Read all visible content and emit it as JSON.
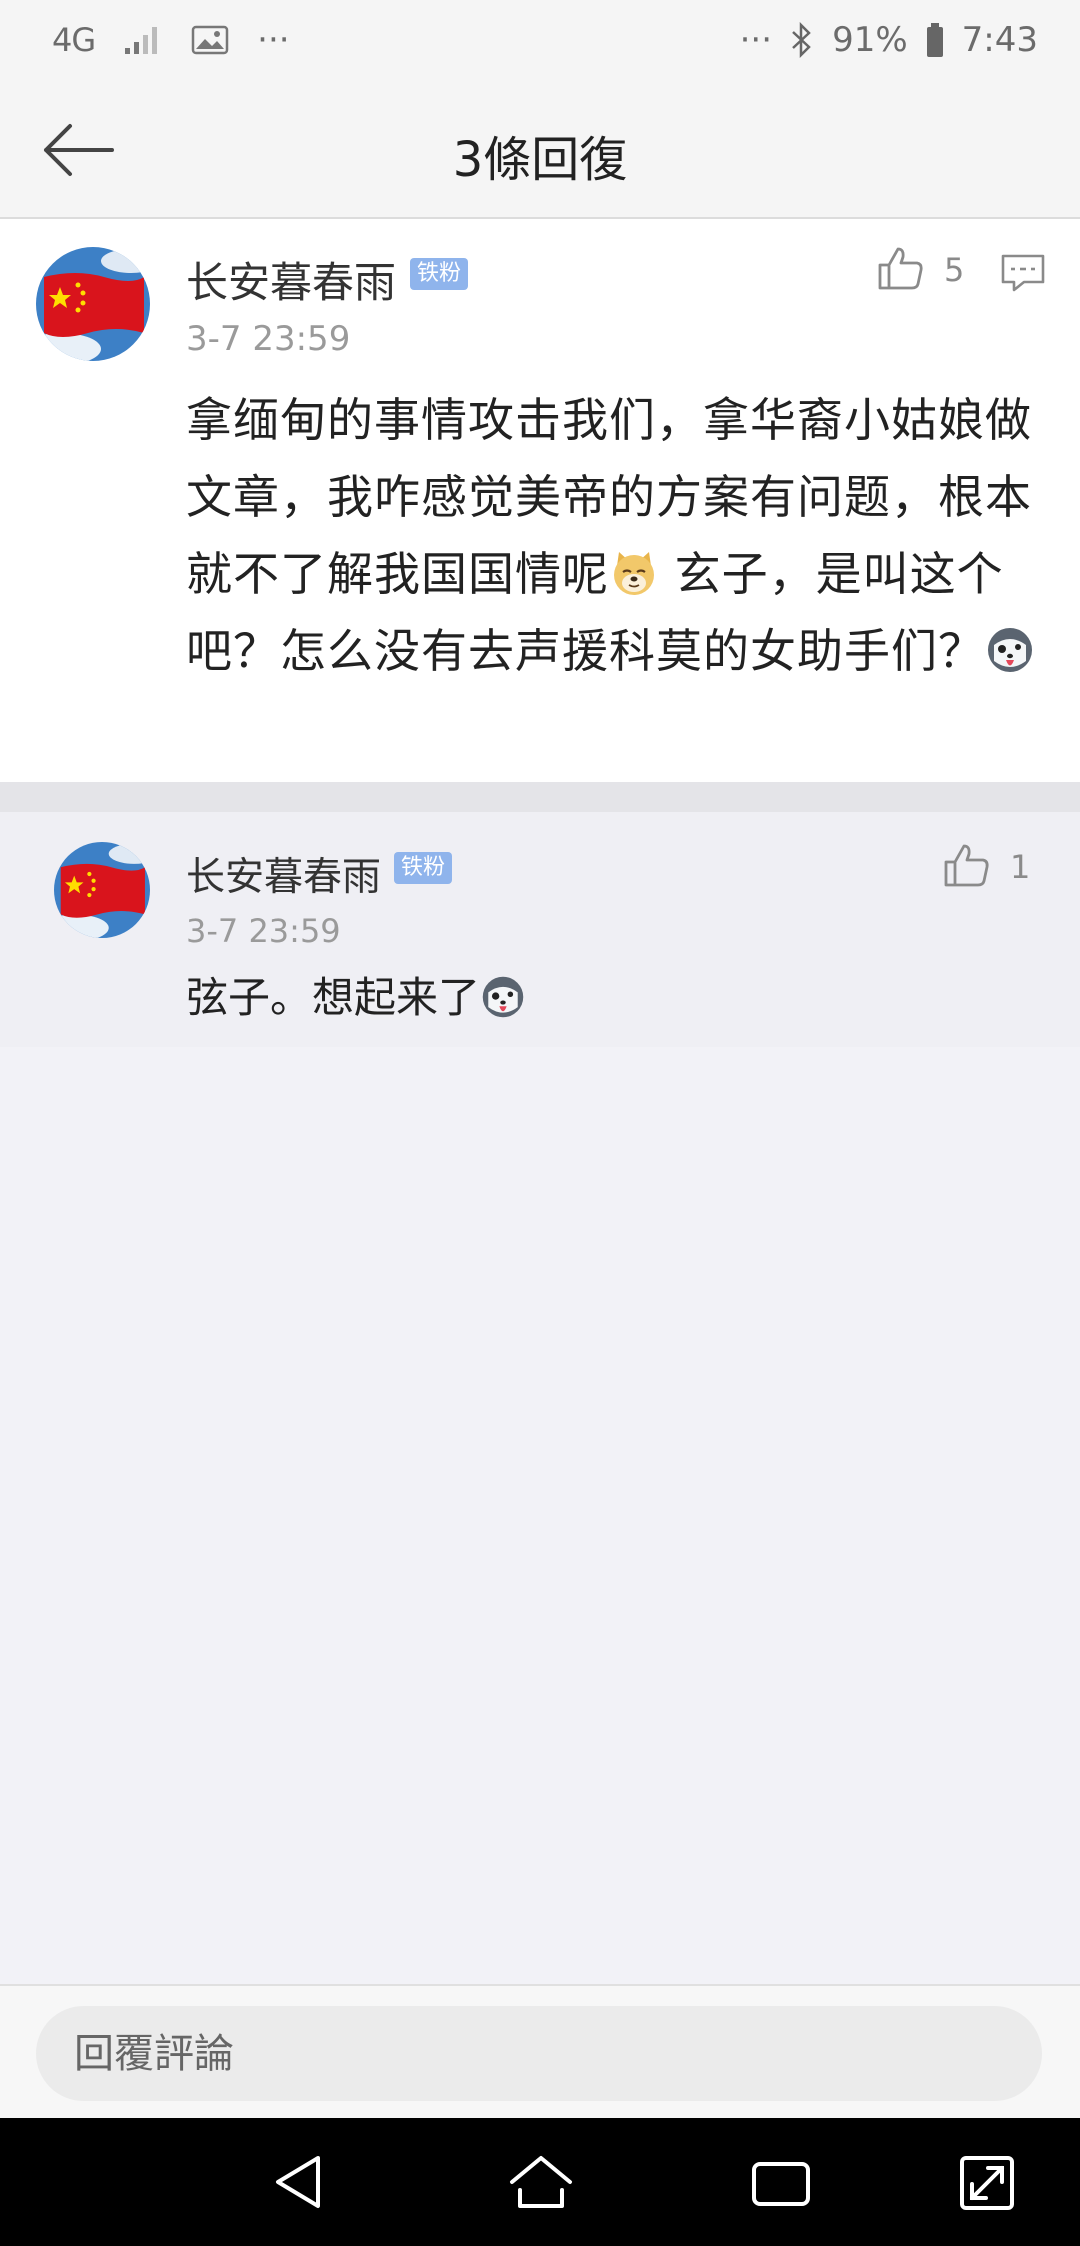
{
  "status_bar": {
    "network": "4G",
    "more_left": "···",
    "more_right": "···",
    "battery": "91%",
    "time": "7:43"
  },
  "header": {
    "title": "3條回復"
  },
  "main_comment": {
    "username": "长安暮春雨",
    "badge": "铁粉",
    "timestamp": "3-7 23:59",
    "likes": "5",
    "text_part1": "拿缅甸的事情攻击我们，拿华裔小姑娘做文章，我咋感觉美帝的方案有问题，根本就不了解我国国情呢",
    "text_part2": " 玄子，是叫这个吧？怎么没有去声援科莫的女助手们？",
    "emoji_1": "doge-emoji",
    "emoji_2": "husky-tongue-emoji"
  },
  "reply": {
    "username": "长安暮春雨",
    "badge": "铁粉",
    "timestamp": "3-7 23:59",
    "likes": "1",
    "text": "弦子。想起来了",
    "emoji": "husky-tongue-emoji"
  },
  "input": {
    "placeholder": "回覆評論"
  },
  "colors": {
    "badge": "#8fb4ec",
    "page_background": "#f2f2f7",
    "nav_bar": "#000000"
  }
}
